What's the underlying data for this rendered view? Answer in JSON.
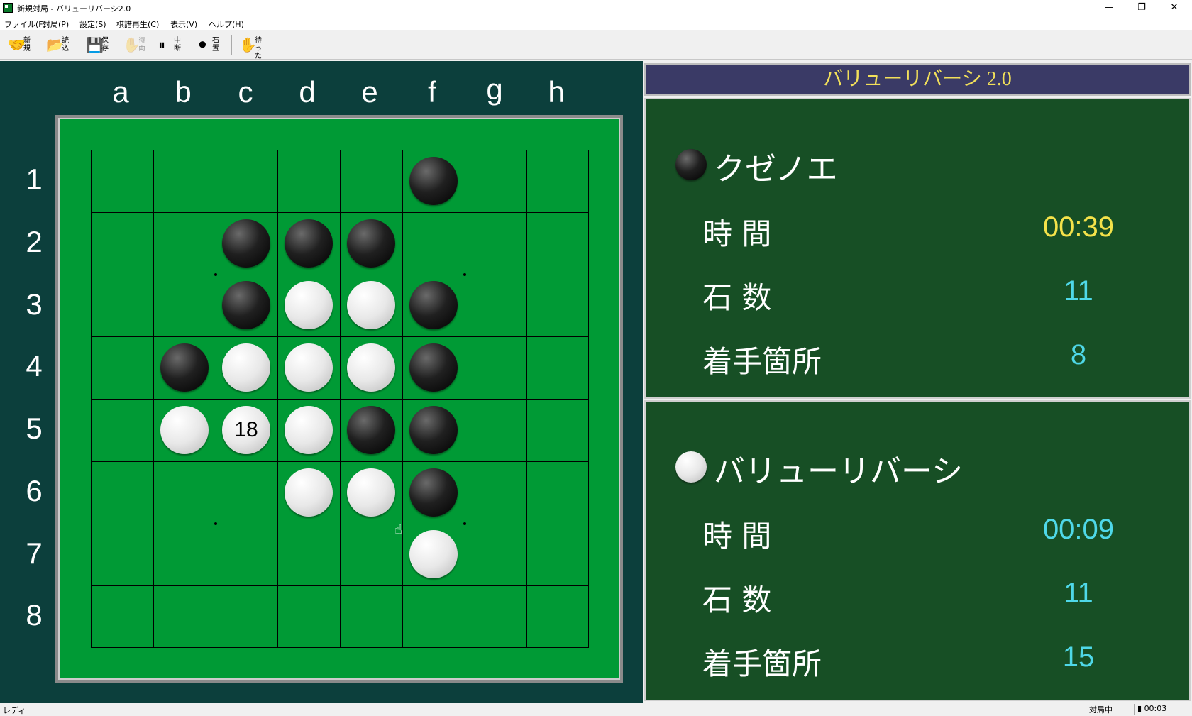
{
  "window": {
    "title": "新規対局 - バリューリバーシ2.0",
    "minimize_glyph": "—",
    "maximize_glyph": "❐",
    "close_glyph": "✕"
  },
  "menu": [
    "ファイル(F)",
    "対局(P)",
    "設定(S)",
    "棋譜再生(C)",
    "表示(V)",
    "ヘルプ(H)"
  ],
  "toolbar": [
    {
      "glyph": "🤝",
      "label": "新規"
    },
    {
      "glyph": "📂",
      "label": "読込"
    },
    {
      "glyph": "💾",
      "label": "保存"
    },
    {
      "glyph": "✋",
      "label": "待両"
    },
    {
      "glyph": "⏸",
      "label": "中断"
    },
    {
      "glyph": "⚫",
      "label": "石置"
    },
    {
      "glyph": "✋",
      "label": "待った"
    }
  ],
  "board": {
    "columns": [
      "a",
      "b",
      "c",
      "d",
      "e",
      "f",
      "g",
      "h"
    ],
    "rows": [
      "1",
      "2",
      "3",
      "4",
      "5",
      "6",
      "7",
      "8"
    ],
    "stones": [
      {
        "col": 5,
        "row": 0,
        "color": "black"
      },
      {
        "col": 2,
        "row": 1,
        "color": "black"
      },
      {
        "col": 3,
        "row": 1,
        "color": "black"
      },
      {
        "col": 4,
        "row": 1,
        "color": "black"
      },
      {
        "col": 2,
        "row": 2,
        "color": "black"
      },
      {
        "col": 3,
        "row": 2,
        "color": "white"
      },
      {
        "col": 4,
        "row": 2,
        "color": "white"
      },
      {
        "col": 5,
        "row": 2,
        "color": "black"
      },
      {
        "col": 1,
        "row": 3,
        "color": "black"
      },
      {
        "col": 2,
        "row": 3,
        "color": "white"
      },
      {
        "col": 3,
        "row": 3,
        "color": "white"
      },
      {
        "col": 4,
        "row": 3,
        "color": "white"
      },
      {
        "col": 5,
        "row": 3,
        "color": "black"
      },
      {
        "col": 1,
        "row": 4,
        "color": "white"
      },
      {
        "col": 2,
        "row": 4,
        "color": "white",
        "label": "18"
      },
      {
        "col": 3,
        "row": 4,
        "color": "white"
      },
      {
        "col": 4,
        "row": 4,
        "color": "black"
      },
      {
        "col": 5,
        "row": 4,
        "color": "black"
      },
      {
        "col": 3,
        "row": 5,
        "color": "white"
      },
      {
        "col": 4,
        "row": 5,
        "color": "white"
      },
      {
        "col": 5,
        "row": 5,
        "color": "black"
      },
      {
        "col": 5,
        "row": 6,
        "color": "white"
      }
    ]
  },
  "header": {
    "title": "バリューリバーシ 2.0"
  },
  "players": [
    {
      "color": "black",
      "name": "クゼノエ",
      "time_label": "時 間",
      "time_value": "00:39",
      "stones_label": "石 数",
      "stones_value": "11",
      "moves_label": "着手箇所",
      "moves_value": "8"
    },
    {
      "color": "white",
      "name": "バリューリバーシ",
      "time_label": "時 間",
      "time_value": "00:09",
      "stones_label": "石 数",
      "stones_value": "11",
      "moves_label": "着手箇所",
      "moves_value": "15"
    }
  ],
  "status": {
    "left": "レディ",
    "state": "対局中",
    "clock": "00:03"
  },
  "colors": {
    "board_green": "#009a35",
    "panel_green": "#174f25",
    "header_bg": "#3a3a66",
    "title_yellow": "#f2e05a",
    "value_cyan": "#4fd8e8"
  }
}
